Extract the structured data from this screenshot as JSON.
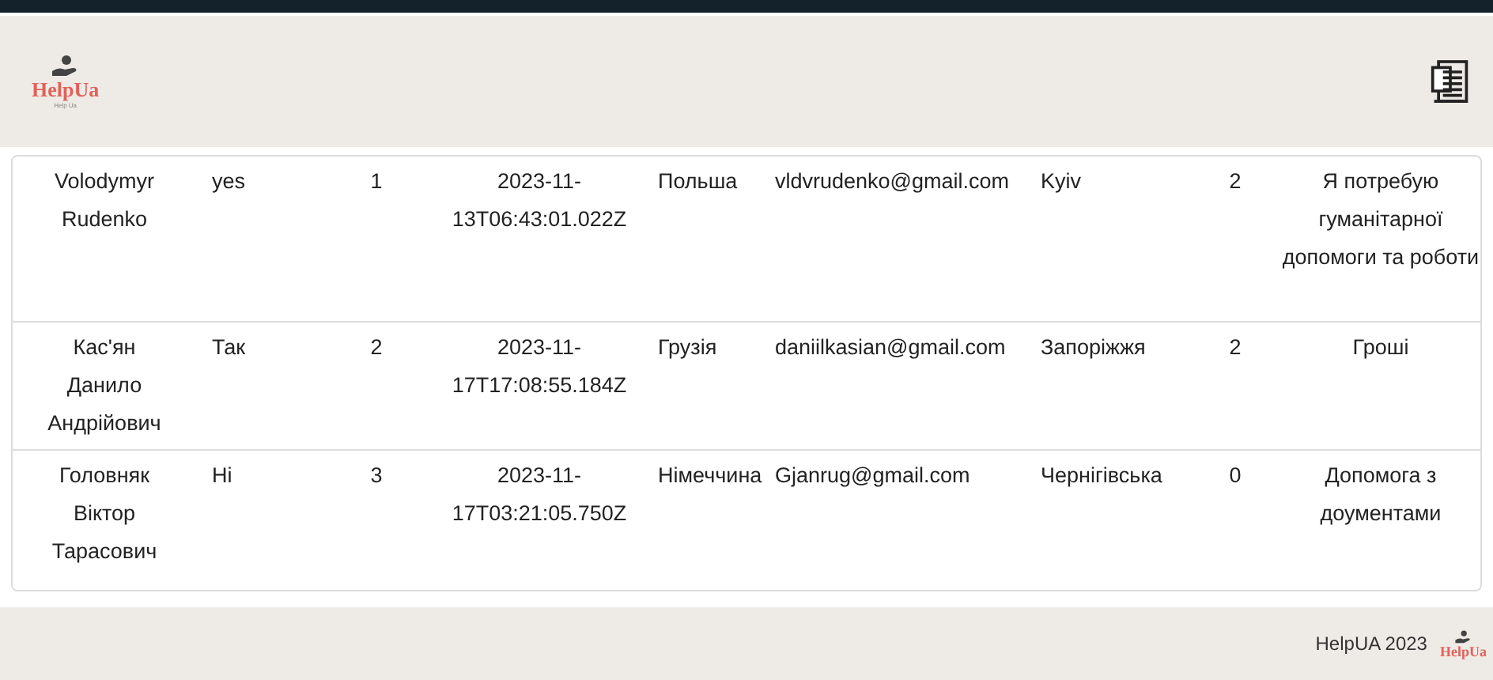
{
  "header": {
    "logo_text": "HelpUa",
    "logo_tagline": "Help Ua"
  },
  "rows": [
    {
      "cells": [
        "Volodymyr Rudenko",
        "yes",
        "1",
        "2023-11-13T06:43:01.022Z",
        "Польша",
        "vldvrudenko@gmail.com",
        "Kyiv",
        "2",
        "Я потребую гуманітарної допомоги та роботи"
      ]
    },
    {
      "cells": [
        "Кас'ян Данило Андрійович",
        "Так",
        "2",
        "2023-11-17T17:08:55.184Z",
        "Грузія",
        "daniilkasian@gmail.com",
        "Запоріжжя",
        "2",
        "Гроші"
      ]
    },
    {
      "cells": [
        "Головняк Віктор Тарасович",
        "Ні",
        "3",
        "2023-11-17T03:21:05.750Z",
        "Німеччина",
        "Gjanrug@gmail.com",
        "Чернігівська",
        "0",
        "Допомога з доументами"
      ]
    }
  ],
  "footer": {
    "text": "HelpUA 2023",
    "logo_text": "HelpUa"
  }
}
